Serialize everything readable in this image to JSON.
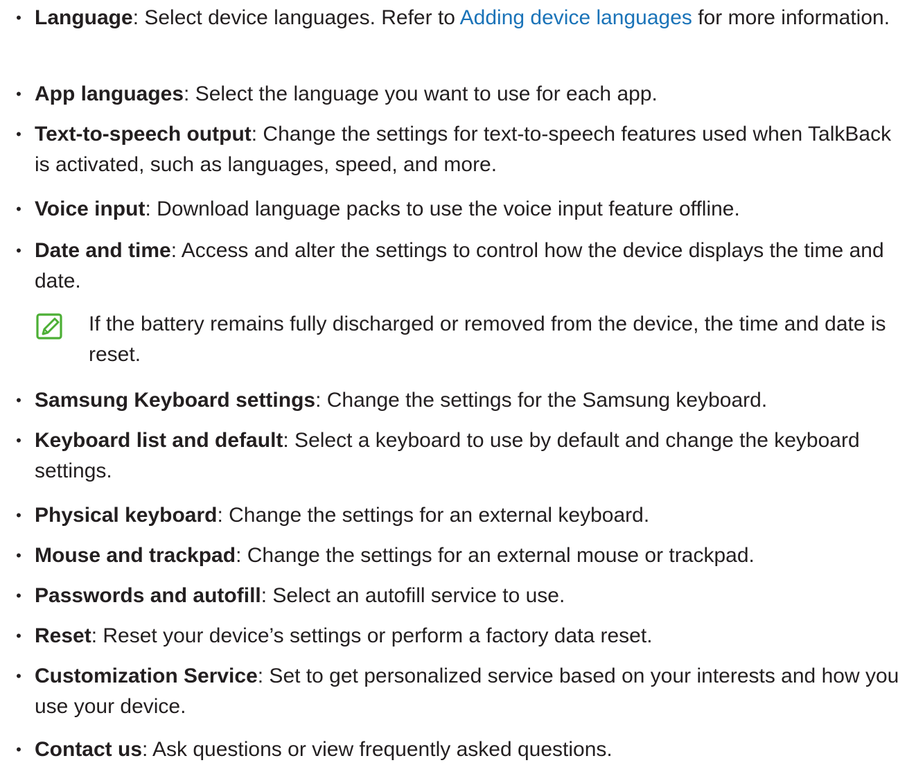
{
  "colors": {
    "text": "#231f20",
    "link": "#1a73b8",
    "note_icon": "#4caf35"
  },
  "items": [
    {
      "term": "Language",
      "pre": ": Select device languages. Refer to ",
      "link": "Adding device languages",
      "post": " for more information."
    },
    {
      "term": "App languages",
      "desc": ": Select the language you want to use for each app."
    },
    {
      "term": "Text-to-speech output",
      "desc": ": Change the settings for text-to-speech features used when TalkBack is activated, such as languages, speed, and more."
    },
    {
      "term": "Voice input",
      "desc": ": Download language packs to use the voice input feature offline."
    },
    {
      "term": "Date and time",
      "desc": ": Access and alter the settings to control how the device displays the time and date."
    },
    {
      "term": "Samsung Keyboard settings",
      "desc": ": Change the settings for the Samsung keyboard."
    },
    {
      "term": "Keyboard list and default",
      "desc": ": Select a keyboard to use by default and change the keyboard settings."
    },
    {
      "term": "Physical keyboard",
      "desc": ": Change the settings for an external keyboard."
    },
    {
      "term": "Mouse and trackpad",
      "desc": ": Change the settings for an external mouse or trackpad."
    },
    {
      "term": "Passwords and autofill",
      "desc": ": Select an autofill service to use."
    },
    {
      "term": "Reset",
      "desc": ": Reset your device’s settings or perform a factory data reset."
    },
    {
      "term": "Customization Service",
      "desc": ": Set to get personalized service based on your interests and how you use your device."
    },
    {
      "term": "Contact us",
      "desc": ": Ask questions or view frequently asked questions."
    }
  ],
  "note": {
    "icon": "note-pencil-icon",
    "text": "If the battery remains fully discharged or removed from the device, the time and date is reset."
  },
  "bullet_char": "•"
}
